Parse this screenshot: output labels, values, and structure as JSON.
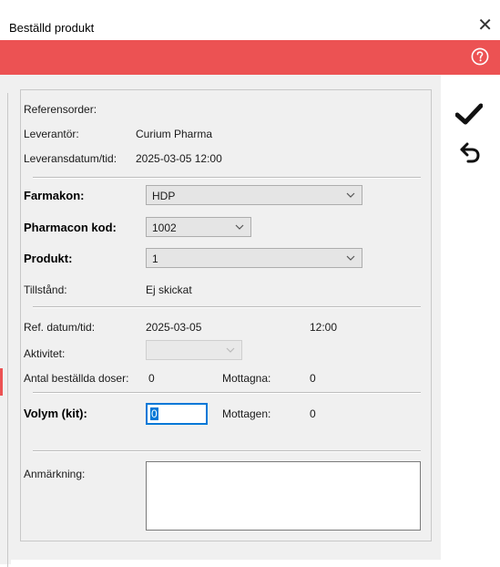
{
  "window": {
    "title": "Beställd produkt",
    "close_symbol": "✕"
  },
  "toolbar": {
    "help_icon": "question-circle-icon",
    "confirm_icon": "checkmark-icon",
    "undo_icon": "undo-arrow-icon"
  },
  "colors": {
    "accent_bar": "#ec5253",
    "panel_bg": "#f0f0f0",
    "focus": "#0078d7"
  },
  "info": {
    "reference_order_label": "Referensorder:",
    "reference_order_value": "",
    "supplier_label": "Leverantör:",
    "supplier_value": "Curium Pharma",
    "delivery_label": "Leveransdatum/tid:",
    "delivery_value": "2025-03-05 12:00"
  },
  "form": {
    "drug_label": "Farmakon:",
    "drug_value": "HDP",
    "pharmacon_code_label": "Pharmacon kod:",
    "pharmacon_code_value": "1002",
    "product_label": "Produkt:",
    "product_value": "1",
    "permit_label": "Tillstånd:",
    "permit_value": "Ej skickat"
  },
  "reference": {
    "ref_datetime_label": "Ref. datum/tid:",
    "ref_date_value": "2025-03-05",
    "ref_time_value": "12:00",
    "activity_label": "Aktivitet:",
    "activity_value": "",
    "ordered_doses_label": "Antal beställda doser:",
    "ordered_doses_value": "0",
    "received_label": "Mottagna:",
    "received_value": "0"
  },
  "volume": {
    "label": "Volym (kit):",
    "value": "0",
    "received_label": "Mottagen:",
    "received_value": "0"
  },
  "remark": {
    "label": "Anmärkning:",
    "value": ""
  }
}
